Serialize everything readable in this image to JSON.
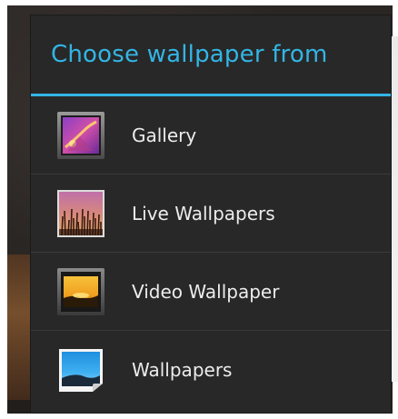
{
  "dialog": {
    "title": "Choose wallpaper from",
    "accent_color": "#33b5e5",
    "items": [
      {
        "label": "Gallery",
        "icon": "gallery-icon"
      },
      {
        "label": "Live Wallpapers",
        "icon": "live-wallpapers-icon"
      },
      {
        "label": "Video Wallpaper",
        "icon": "video-wallpaper-icon"
      },
      {
        "label": "Wallpapers",
        "icon": "wallpapers-icon"
      }
    ]
  }
}
